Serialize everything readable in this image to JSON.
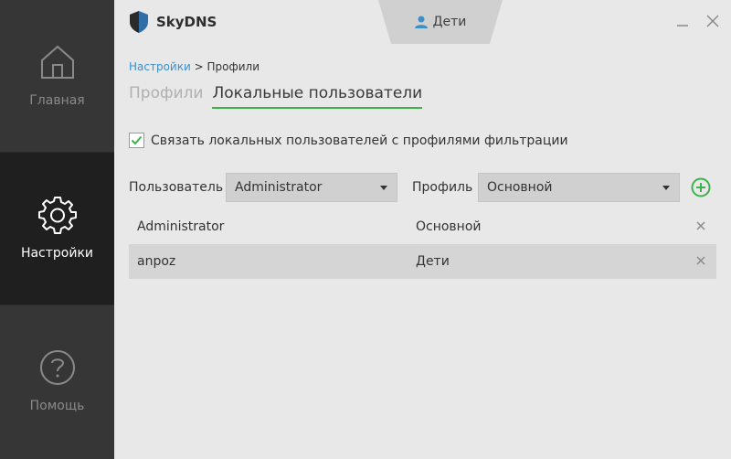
{
  "app": {
    "name": "SkyDNS"
  },
  "header": {
    "active_profile": "Дети"
  },
  "sidebar": {
    "items": [
      {
        "label": "Главная",
        "icon": "home-icon"
      },
      {
        "label": "Настройки",
        "icon": "gear-icon"
      },
      {
        "label": "Помощь",
        "icon": "help-icon"
      }
    ]
  },
  "breadcrumb": {
    "parent": "Настройки",
    "separator": ">",
    "current": "Профили"
  },
  "tabs": [
    {
      "label": "Профили"
    },
    {
      "label": "Локальные пользователи"
    }
  ],
  "link_users": {
    "label": "Связать локальных пользователей с профилями фильтрации",
    "checked": true
  },
  "form": {
    "user_label": "Пользователь",
    "user_value": "Administrator",
    "profile_label": "Профиль",
    "profile_value": "Основной"
  },
  "table": {
    "rows": [
      {
        "user": "Administrator",
        "profile": "Основной"
      },
      {
        "user": "anpoz",
        "profile": "Дети"
      }
    ]
  },
  "colors": {
    "accent_green": "#3db24a",
    "link_blue": "#3d8fc7",
    "sidebar_bg": "#363636",
    "sidebar_active": "#1f1f1f"
  }
}
